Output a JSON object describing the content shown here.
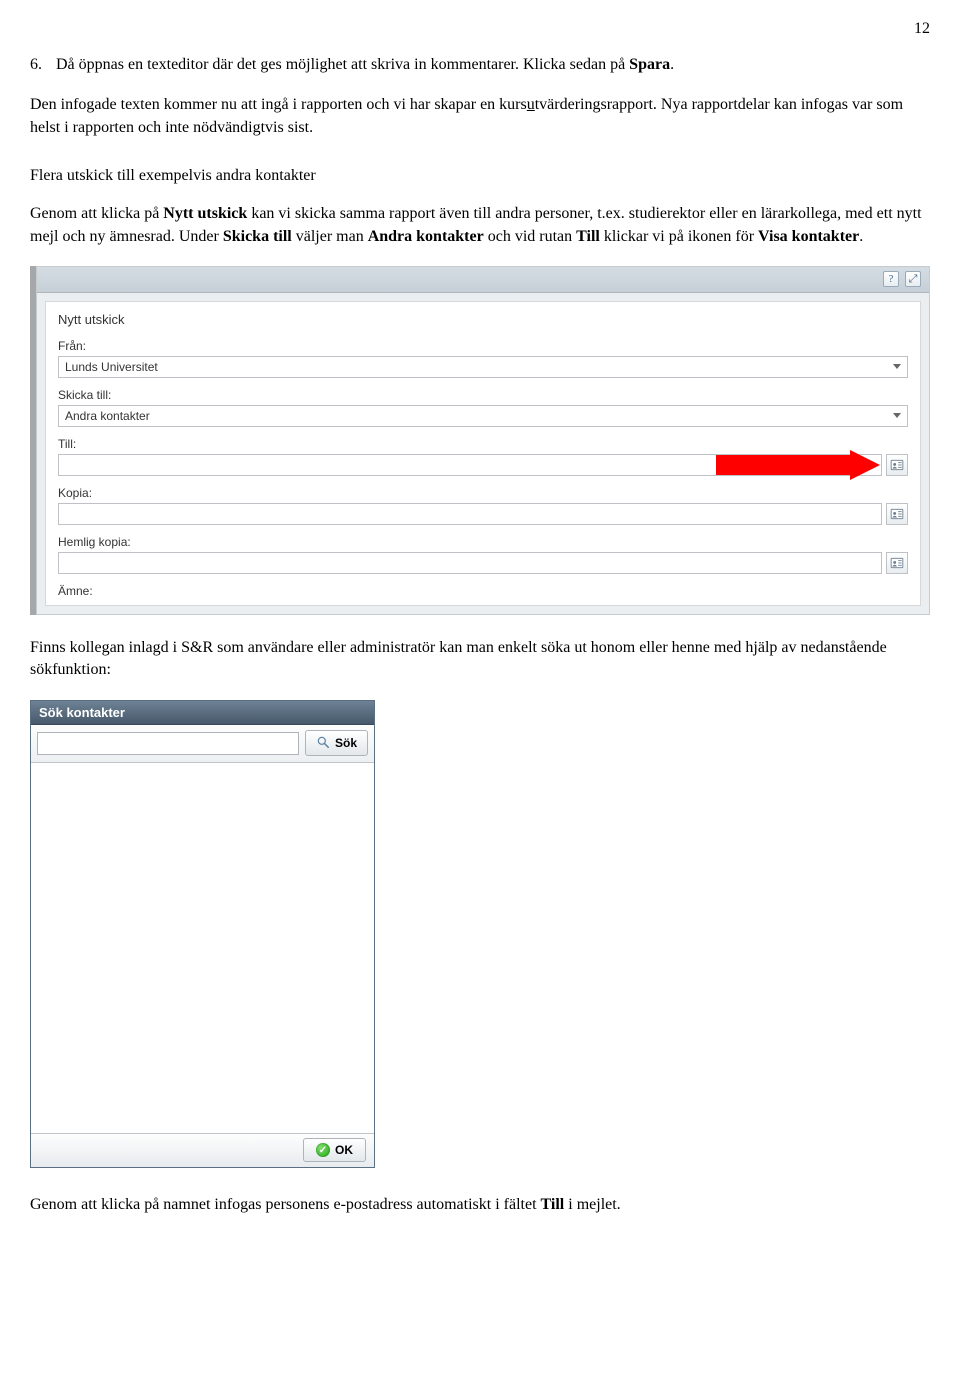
{
  "page_number": "12",
  "step6": {
    "num": "6.",
    "text_a": "Då öppnas en texteditor där det ges möjlighet att skriva in kommentarer. Klicka sedan på ",
    "text_b": "Spara",
    "text_c": "."
  },
  "para1": {
    "a": "Den infogade texten kommer nu att ingå i rapporten och vi har skapar en kurs",
    "u": "u",
    "b": "tvärderingsrapport. Nya rapportdelar kan infogas var som helst i rapporten och inte nödvändigtvis sist."
  },
  "section_head": "Flera utskick till exempelvis andra kontakter",
  "para2": {
    "a": "Genom att klicka på ",
    "b": "Nytt utskick",
    "c": " kan vi skicka samma rapport även till andra personer, t.ex. studierektor eller en lärarkollega, med ett nytt mejl och ny ämnesrad. Under ",
    "d": "Skicka till",
    "e": " väljer man ",
    "f": "Andra kontakter",
    "g": " och vid rutan ",
    "h": "Till",
    "i": " klickar vi på ikonen för ",
    "j": "Visa kontakter",
    "k": "."
  },
  "form": {
    "title": "Nytt utskick",
    "from_label": "Från:",
    "from_value": "Lunds Universitet",
    "sendto_label": "Skicka till:",
    "sendto_value": "Andra kontakter",
    "to_label": "Till:",
    "to_value": "",
    "cc_label": "Kopia:",
    "cc_value": "",
    "bcc_label": "Hemlig kopia:",
    "bcc_value": "",
    "subject_label": "Ämne:"
  },
  "para3": {
    "a": "Finns kollegan inlagd i S&R som användare eller administratör kan man enkelt söka ut honom eller henne med hjälp av nedanstående sökfunktion:"
  },
  "searchbox": {
    "title": "Sök kontakter",
    "search_button": "Sök",
    "ok_button": "OK"
  },
  "para4": {
    "a": "Genom att klicka på namnet infogas personens e-postadress automatiskt i fältet ",
    "b": "Till",
    "c": " i mejlet."
  }
}
